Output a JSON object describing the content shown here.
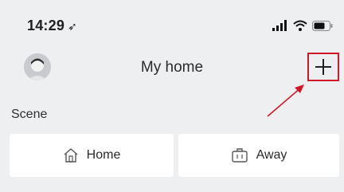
{
  "status_bar": {
    "time": "14:29",
    "location_icon": "location-arrow-icon",
    "signal_icon": "signal-bars-icon",
    "wifi_icon": "wifi-icon",
    "battery_icon": "battery-icon"
  },
  "header": {
    "title": "My home",
    "avatar_icon": "user-avatar-icon",
    "add_icon": "plus-icon"
  },
  "scene": {
    "label": "Scene",
    "items": [
      {
        "label": "Home",
        "icon": "home-icon"
      },
      {
        "label": "Away",
        "icon": "briefcase-icon"
      }
    ]
  },
  "colors": {
    "background": "#eeeff1",
    "card": "#ffffff",
    "highlight": "#d0172a"
  }
}
